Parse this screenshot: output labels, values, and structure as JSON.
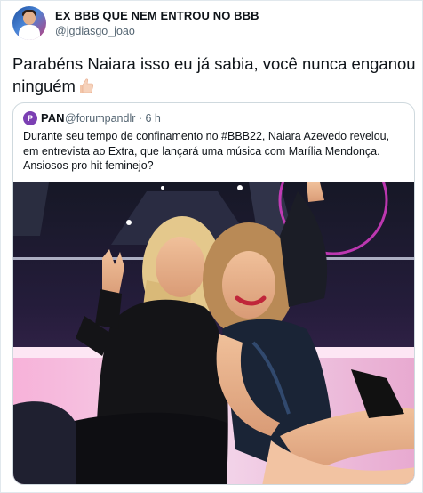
{
  "author": {
    "name": "EX BBB QUE NEM ENTROU NO BBB",
    "handle": "@jgdiasgo_joao"
  },
  "tweet": {
    "text": "Parabéns Naiara isso eu já sabia, você nunca enganou ninguém",
    "emoji_icon": "thumbs-up-icon"
  },
  "quoted": {
    "avatar_letter": "P",
    "name": "PAN",
    "handle": "@forumpandlr · 6 h",
    "text": "Durante seu tempo de confinamento no #BBB22, Naiara Azevedo revelou, em entrevista ao Extra, que lançará uma música com Marília Mendonça. Ansiosos pro hit feminejo?"
  },
  "colors": {
    "text": "#0f1419",
    "secondary": "#536471",
    "border": "#cfd9de",
    "pan_brand": "#7b3fb3"
  }
}
